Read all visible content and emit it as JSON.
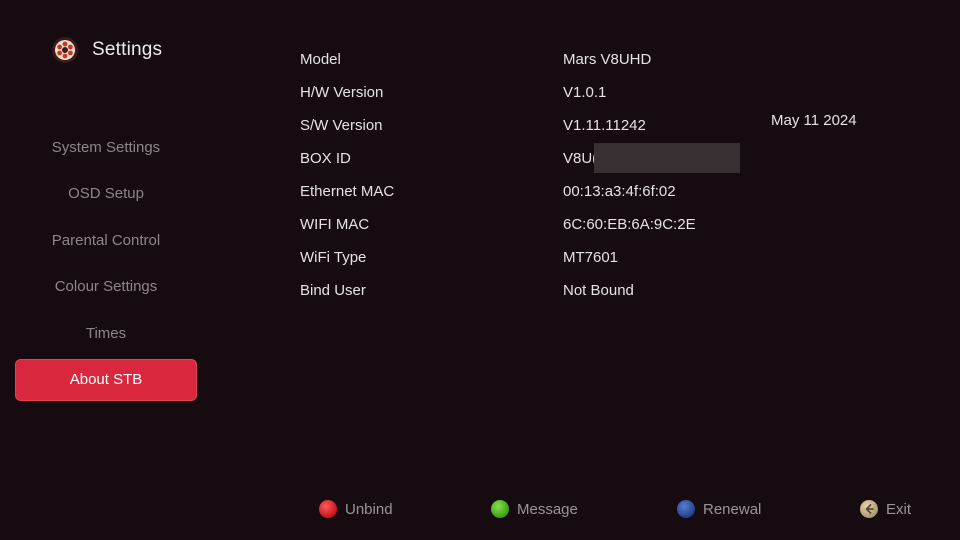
{
  "header": {
    "title": "Settings",
    "icon": "film-reel-icon"
  },
  "sidebar": {
    "items": [
      {
        "label": "System Settings",
        "active": false
      },
      {
        "label": "OSD Setup",
        "active": false
      },
      {
        "label": "Parental Control",
        "active": false
      },
      {
        "label": "Colour Settings",
        "active": false
      },
      {
        "label": "Times",
        "active": false
      },
      {
        "label": "About STB",
        "active": true
      }
    ],
    "active_color": "#d9283e"
  },
  "info": {
    "rows": [
      {
        "label": "Model",
        "value": "Mars V8UHD"
      },
      {
        "label": "H/W Version",
        "value": "V1.0.1"
      },
      {
        "label": "S/W Version",
        "value": "V1.11.11242"
      },
      {
        "label": "BOX ID",
        "value": "V8U("
      },
      {
        "label": "Ethernet MAC",
        "value": "00:13:a3:4f:6f:02"
      },
      {
        "label": "WIFI MAC",
        "value": "6C:60:EB:6A:9C:2E"
      },
      {
        "label": "WiFi Type",
        "value": "MT7601"
      },
      {
        "label": "Bind User",
        "value": "Not Bound"
      }
    ],
    "build_date": "May 11 2024"
  },
  "footer": {
    "keys": [
      {
        "label": "Unbind",
        "color": "#d61a22",
        "icon": "red-button-icon"
      },
      {
        "label": "Message",
        "color": "#4caf1e",
        "icon": "green-button-icon"
      },
      {
        "label": "Renewal",
        "color": "#2e4f9e",
        "icon": "blue-button-icon"
      },
      {
        "label": "Exit",
        "color": "#cdb78e",
        "icon": "back-arrow-icon"
      }
    ]
  }
}
